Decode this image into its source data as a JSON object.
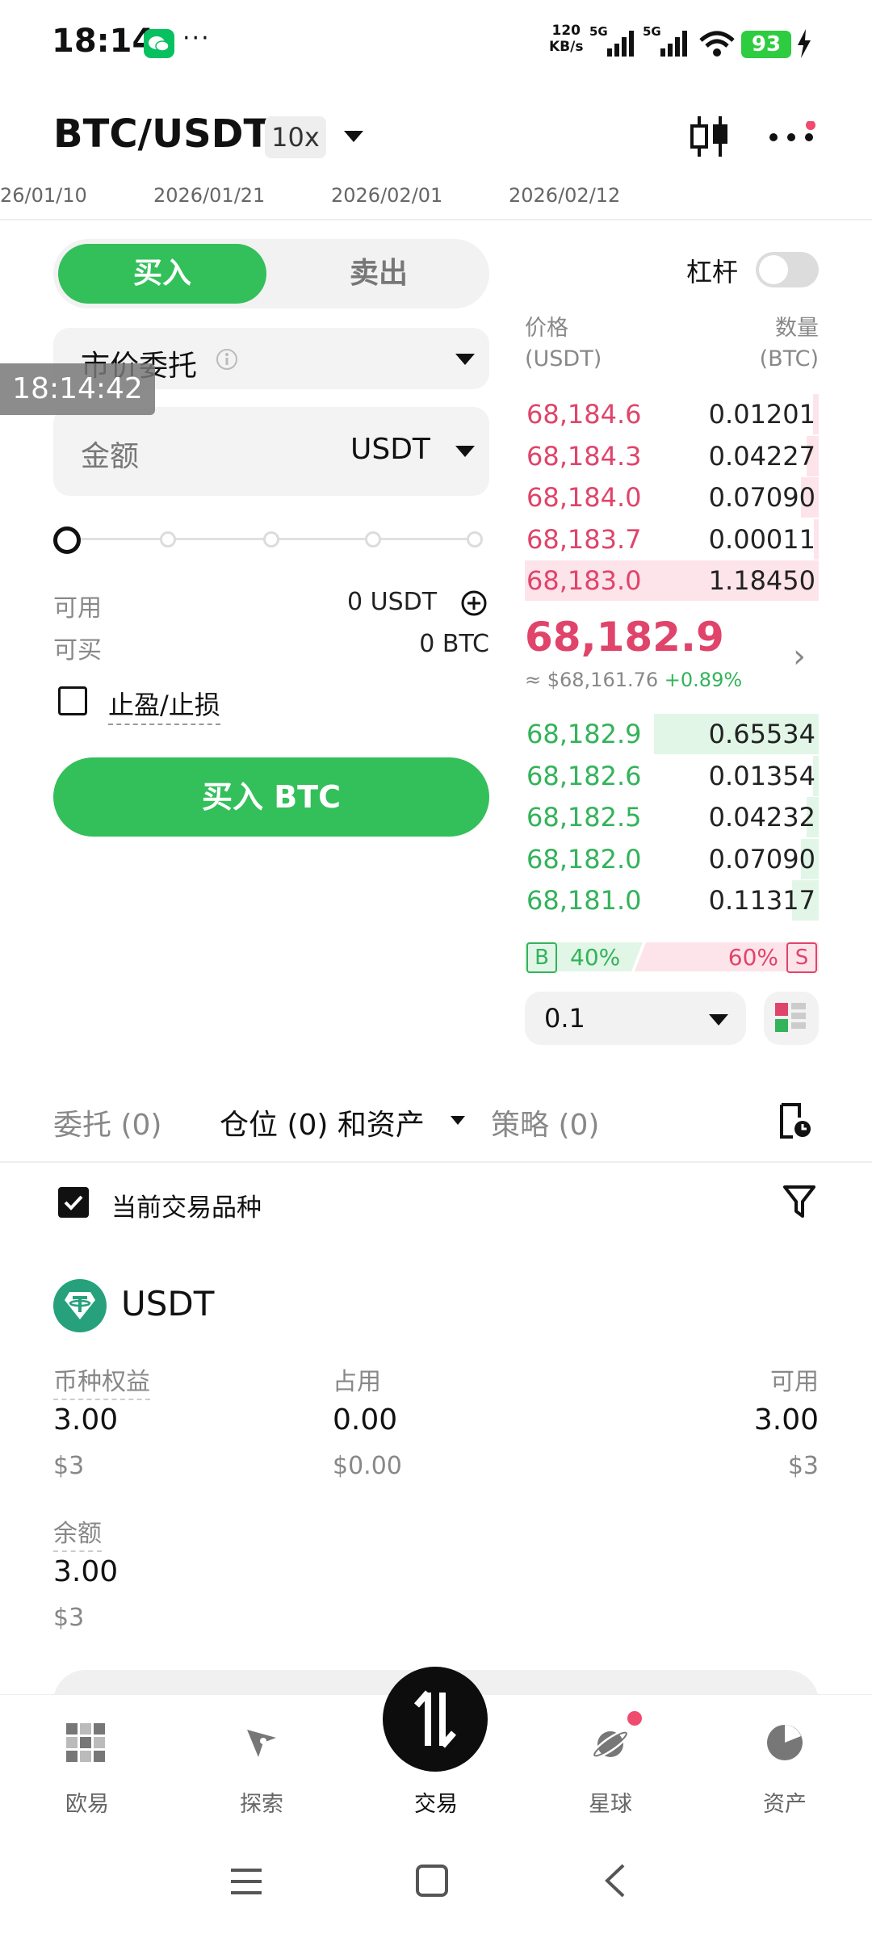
{
  "status_bar": {
    "time": "18:14",
    "net_speed_value": "120",
    "net_speed_unit": "KB/s",
    "signal_1": "5G",
    "signal_2": "5G",
    "battery": "93"
  },
  "header": {
    "pair": "BTC/USDT",
    "leverage": "10x"
  },
  "timeline": [
    "26/01/10",
    "2026/01/21",
    "2026/02/01",
    "2026/02/12"
  ],
  "order_panel": {
    "buy_tab": "买入",
    "sell_tab": "卖出",
    "order_type": "市价委托",
    "amount_placeholder": "金额",
    "amount_unit": "USDT",
    "slider_percent": 0,
    "available_label": "可用",
    "available_value": "0 USDT",
    "can_buy_label": "可买",
    "can_buy_value": "0 BTC",
    "tp_sl_label": "止盈/止损",
    "submit_label": "买入 BTC"
  },
  "leverage_toggle": {
    "label": "杠杆",
    "on": false
  },
  "order_book": {
    "price_header": "价格",
    "price_unit": "(USDT)",
    "qty_header": "数量",
    "qty_unit": "(BTC)",
    "asks": [
      {
        "price": "68,184.6",
        "qty": "0.01201",
        "depth": 0.02
      },
      {
        "price": "68,184.3",
        "qty": "0.04227",
        "depth": 0.04
      },
      {
        "price": "68,184.0",
        "qty": "0.07090",
        "depth": 0.06
      },
      {
        "price": "68,183.7",
        "qty": "0.00011",
        "depth": 0.01
      },
      {
        "price": "68,183.0",
        "qty": "1.18450",
        "depth": 1.0
      }
    ],
    "last_price": "68,182.9",
    "ref_price": "≈ $68,161.76",
    "change": "+0.89%",
    "bids": [
      {
        "price": "68,182.9",
        "qty": "0.65534",
        "depth": 0.56
      },
      {
        "price": "68,182.6",
        "qty": "0.01354",
        "depth": 0.02
      },
      {
        "price": "68,182.5",
        "qty": "0.04232",
        "depth": 0.04
      },
      {
        "price": "68,182.0",
        "qty": "0.07090",
        "depth": 0.06
      },
      {
        "price": "68,181.0",
        "qty": "0.11317",
        "depth": 0.09
      }
    ],
    "buy_badge": "B",
    "buy_ratio": "40%",
    "sell_ratio": "60%",
    "sell_badge": "S",
    "depth_step": "0.1"
  },
  "tabs": [
    {
      "label": "委托 (0)",
      "active": false
    },
    {
      "label": "仓位 (0) 和资产",
      "active": true
    },
    {
      "label": "策略 (0)",
      "active": false
    }
  ],
  "positions": {
    "current_only_label": "当前交易品种",
    "current_only_checked": true,
    "coin": "USDT",
    "equity_label": "币种权益",
    "equity_value": "3.00",
    "equity_usd": "$3",
    "used_label": "占用",
    "used_value": "0.00",
    "used_usd": "$0.00",
    "avail_label": "可用",
    "avail_value": "3.00",
    "avail_usd": "$3",
    "balance_label": "余额",
    "balance_value": "3.00",
    "balance_usd": "$3"
  },
  "bottom_nav": [
    {
      "label": "欧易",
      "icon": "okx-logo-icon"
    },
    {
      "label": "探索",
      "icon": "compass-icon"
    },
    {
      "label": "交易",
      "icon": "trade-arrows-icon",
      "active": true
    },
    {
      "label": "星球",
      "icon": "planet-icon"
    },
    {
      "label": "资产",
      "icon": "pie-chart-icon"
    }
  ],
  "overlay_time": "18:14:42",
  "colors": {
    "buy_green": "#33bf5a",
    "sell_red": "#e0446a",
    "ask_bar": "#fde4ea",
    "bid_bar": "#e2f6e7"
  }
}
